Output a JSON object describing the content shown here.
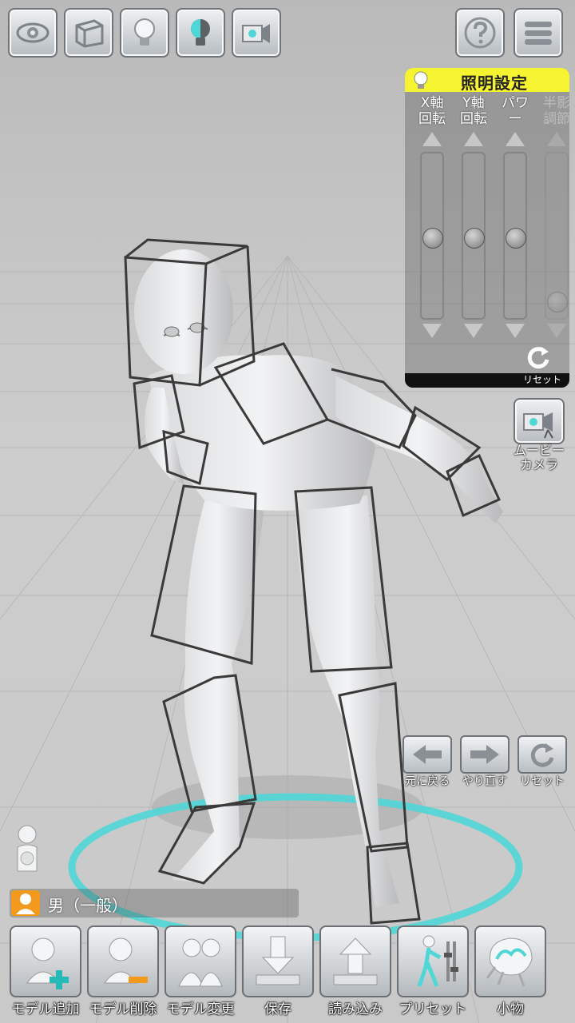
{
  "toolbar": {
    "buttons": [
      {
        "icon": "eye-icon"
      },
      {
        "icon": "cube-frame-icon"
      },
      {
        "icon": "lightbulb-icon"
      },
      {
        "icon": "lightbulb-half-icon"
      },
      {
        "icon": "camera-icon"
      }
    ],
    "help_icon": "help-icon",
    "menu_icon": "menu-icon"
  },
  "lighting_panel": {
    "title": "照明設定",
    "sliders": [
      {
        "label": "X軸\n回転",
        "level": 0.5,
        "enabled": true
      },
      {
        "label": "Y軸\n回転",
        "level": 0.5,
        "enabled": true
      },
      {
        "label": "パワ\nー",
        "level": 0.5,
        "enabled": true
      },
      {
        "label": "半影\n調節",
        "level": 0.95,
        "enabled": false
      }
    ],
    "reset_label": "リセット"
  },
  "movie_camera": {
    "label": "ムービー\nカメラ"
  },
  "history": {
    "undo_label": "元に戻る",
    "redo_label": "やり直す",
    "reset_label": "リセット"
  },
  "model": {
    "name": "男（一般）"
  },
  "bottom_bar": {
    "items": [
      {
        "label": "モデル追加",
        "icon": "add-model-icon"
      },
      {
        "label": "モデル削除",
        "icon": "remove-model-icon"
      },
      {
        "label": "モデル変更",
        "icon": "change-model-icon"
      },
      {
        "label": "保存",
        "icon": "save-icon"
      },
      {
        "label": "読み込み",
        "icon": "load-icon"
      },
      {
        "label": "プリセット",
        "icon": "preset-icon"
      },
      {
        "label": "小物",
        "icon": "props-icon"
      }
    ]
  },
  "colors": {
    "panel_header": "#f6f430",
    "ring": "#4fd6d6",
    "model_badge": "#f39a1e"
  }
}
